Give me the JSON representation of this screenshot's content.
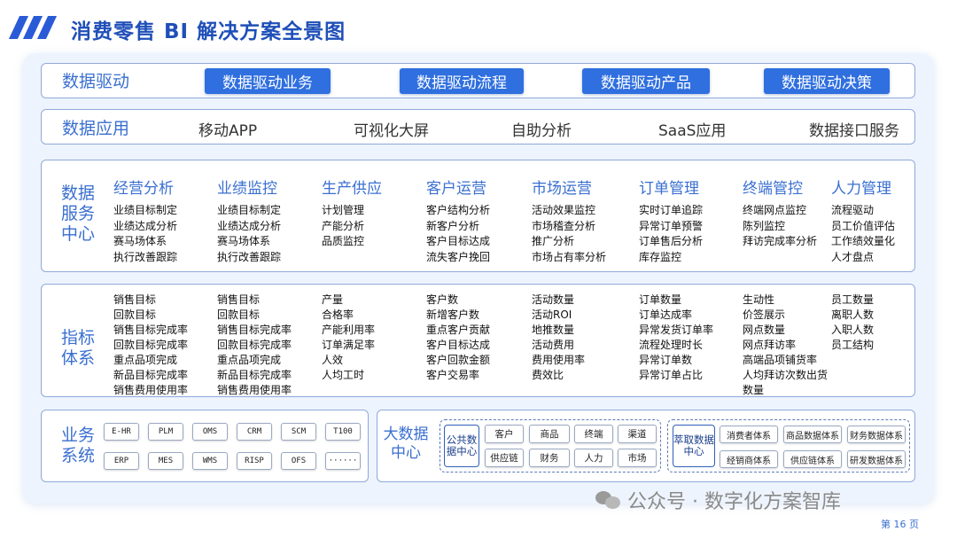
{
  "header": {
    "title": "消费零售 BI 解决方案全景图"
  },
  "drive": {
    "label": "数据驱动",
    "buttons": [
      "数据驱动业务",
      "数据驱动流程",
      "数据驱动产品",
      "数据驱动决策"
    ]
  },
  "apps": {
    "label": "数据应用",
    "items": [
      "移动APP",
      "可视化大屏",
      "自助分析",
      "SaaS应用",
      "数据接口服务"
    ]
  },
  "service": {
    "label": "数据服务中心",
    "columns": [
      {
        "title": "经营分析",
        "items": [
          "业绩目标制定",
          "业绩达成分析",
          "赛马场体系",
          "执行改善跟踪"
        ]
      },
      {
        "title": "业绩监控",
        "items": [
          "业绩目标制定",
          "业绩达成分析",
          "赛马场体系",
          "执行改善跟踪"
        ]
      },
      {
        "title": "生产供应",
        "items": [
          "计划管理",
          "产能分析",
          "品质监控"
        ]
      },
      {
        "title": "客户运营",
        "items": [
          "客户结构分析",
          "新客户分析",
          "客户目标达成",
          "流失客户挽回"
        ]
      },
      {
        "title": "市场运营",
        "items": [
          "活动效果监控",
          "市场稽查分析",
          "推广分析",
          "市场占有率分析"
        ]
      },
      {
        "title": "订单管理",
        "items": [
          "实时订单追踪",
          "异常订单预警",
          "订单售后分析",
          "库存监控"
        ]
      },
      {
        "title": "终端管控",
        "items": [
          "终端网点监控",
          "陈列监控",
          "拜访完成率分析"
        ]
      },
      {
        "title": "人力管理",
        "items": [
          "流程驱动",
          "员工价值评估",
          "工作绩效量化",
          "人才盘点"
        ]
      }
    ]
  },
  "metrics": {
    "label": "指标体系",
    "columns": [
      [
        "销售目标",
        "回款目标",
        "销售目标完成率",
        "回款目标完成率",
        "重点品项完成",
        "新品目标完成率",
        "销售费用使用率"
      ],
      [
        "销售目标",
        "回款目标",
        "销售目标完成率",
        "回款目标完成率",
        "重点品项完成",
        "新品目标完成率",
        "销售费用使用率"
      ],
      [
        "产量",
        "合格率",
        "产能利用率",
        "订单满足率",
        "人效",
        "人均工时"
      ],
      [
        "客户数",
        "新增客户数",
        "重点客户贡献",
        "客户目标达成",
        "客户回款金额",
        "客户交易率"
      ],
      [
        "活动数量",
        "活动ROI",
        "地推数量",
        "活动费用",
        "费用使用率",
        "费效比"
      ],
      [
        "订单数量",
        "订单达成率",
        "异常发货订单率",
        "流程处理时长",
        "异常订单数",
        "异常订单占比"
      ],
      [
        "生动性",
        "价签展示",
        "网点数量",
        "网点拜访率",
        "高端品项铺货率",
        "人均拜访次数出货",
        "数量"
      ],
      [
        "员工数量",
        "离职人数",
        "入职人数",
        "员工结构"
      ]
    ]
  },
  "systems": {
    "label": "业务系统",
    "row1": [
      "E-HR",
      "PLM",
      "OMS",
      "CRM",
      "SCM",
      "T100"
    ],
    "row2": [
      "ERP",
      "MES",
      "WMS",
      "RISP",
      "OFS",
      "······"
    ]
  },
  "bigdata": {
    "label": "大数据中心",
    "public": {
      "core": "公共数据中心",
      "row1": [
        "客户",
        "商品",
        "终端",
        "渠道"
      ],
      "row2": [
        "供应链",
        "财务",
        "人力",
        "市场"
      ]
    },
    "extract": {
      "core": "萃取数据中心",
      "row1": [
        "消费者体系",
        "商品数据体系",
        "财务数据体系"
      ],
      "row2": [
        "经销商体系",
        "供应链体系",
        "研发数据体系"
      ]
    }
  },
  "watermark": "公众号 · 数字化方案智库",
  "page": "第 16 页"
}
